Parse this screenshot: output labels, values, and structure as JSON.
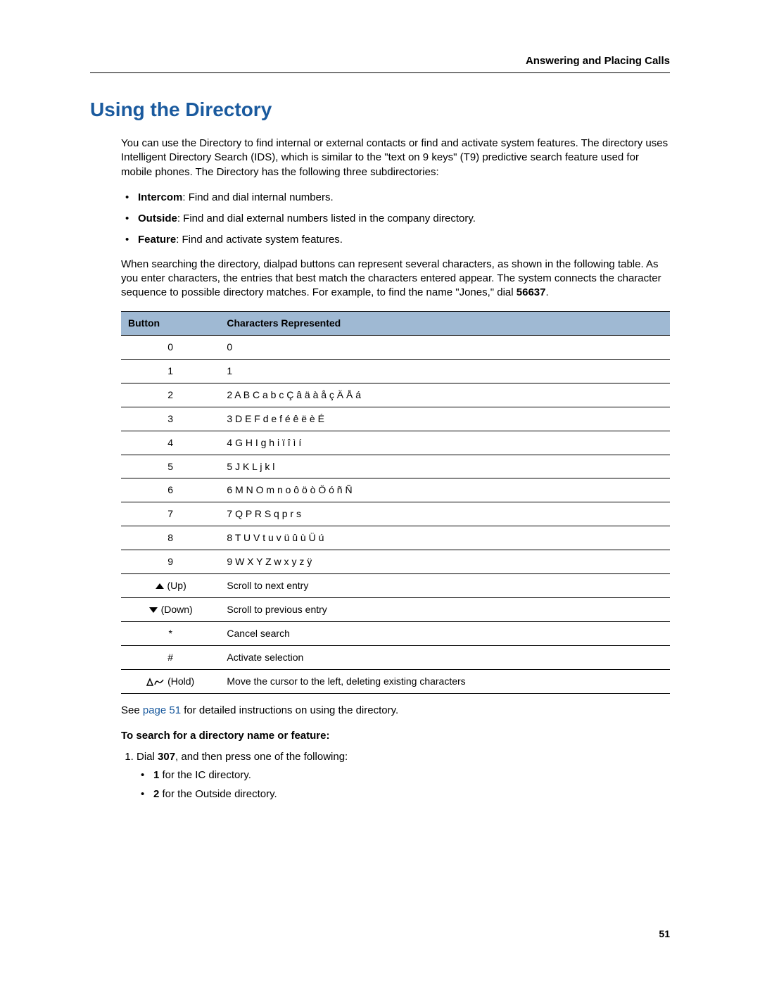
{
  "header": {
    "running_title": "Answering and Placing Calls"
  },
  "title": "Using the Directory",
  "intro": "You can use the Directory to find internal or external contacts or find and activate system features. The directory uses Intelligent Directory Search (IDS), which is similar to the \"text on 9 keys\" (T9) predictive search feature used for mobile phones. The Directory has the following three subdirectories:",
  "subdirs": [
    {
      "name": "Intercom",
      "desc": ": Find and dial internal numbers."
    },
    {
      "name": "Outside",
      "desc": ": Find and dial external numbers listed in the company directory."
    },
    {
      "name": "Feature",
      "desc": ": Find and activate system features."
    }
  ],
  "para2_pre": "When searching the directory, dialpad buttons can represent several characters, as shown in the following table. As you enter characters, the entries that best match the characters entered appear. The system connects the character sequence to possible directory matches. For example, to find the name \"Jones,\" dial ",
  "para2_code": "56637",
  "para2_post": ".",
  "table": {
    "headers": {
      "button": "Button",
      "chars": "Characters Represented"
    },
    "rows": [
      {
        "button": "0",
        "chars": "0"
      },
      {
        "button": "1",
        "chars": "1"
      },
      {
        "button": "2",
        "chars": "2 A B C a b c Ç â ä à å ç Ä Å á"
      },
      {
        "button": "3",
        "chars": "3 D E F d e f é ê ë è É"
      },
      {
        "button": "4",
        "chars": "4 G H I g h i ï î ì í"
      },
      {
        "button": "5",
        "chars": "5 J K L j k l"
      },
      {
        "button": "6",
        "chars": "6 M N O m n o ô ö ò Ö ó ñ Ñ"
      },
      {
        "button": "7",
        "chars": "7 Q P R S q p r s"
      },
      {
        "button": "8",
        "chars": "8 T U V t u v ü û ù Ü ú"
      },
      {
        "button": "9",
        "chars": "9 W X Y Z w x y z ÿ"
      },
      {
        "button_icon": "up",
        "button_suffix": " (Up)",
        "chars": "Scroll to next entry"
      },
      {
        "button_icon": "down",
        "button_suffix": " (Down)",
        "chars": "Scroll to previous entry"
      },
      {
        "button": "*",
        "chars": "Cancel search"
      },
      {
        "button": "#",
        "chars": "Activate selection"
      },
      {
        "button_icon": "hold",
        "button_suffix": " (Hold)",
        "chars": "Move the cursor to the left, deleting existing characters"
      }
    ]
  },
  "afterTable_pre": "See ",
  "afterTable_link": "page 51",
  "afterTable_post": " for detailed instructions on using the directory.",
  "procedure": {
    "title": "To search for a directory name or feature:",
    "step1_prefix": "Dial ",
    "step1_code": "307",
    "step1_suffix": ", and then press one of the following:",
    "subitems": [
      {
        "bold": "1",
        "text": " for the IC directory."
      },
      {
        "bold": "2",
        "text": " for the Outside directory."
      }
    ]
  },
  "page_number": "51"
}
